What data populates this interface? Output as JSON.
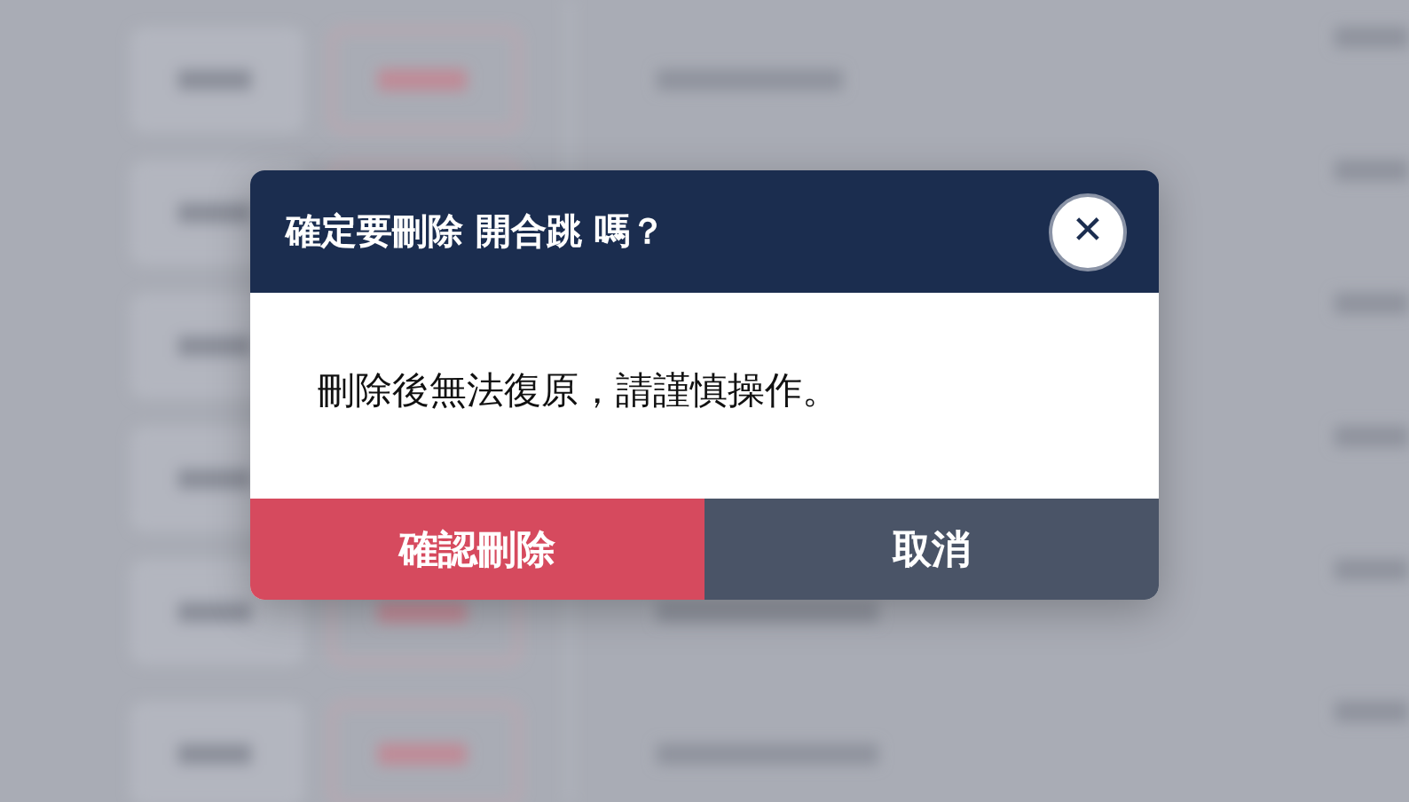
{
  "dialog": {
    "title": "確定要刪除 開合跳 嗎？",
    "close_icon": "✕",
    "message": "刪除後無法復原，請謹慎操作。",
    "buttons": [
      {
        "label": "確認刪除",
        "kind": "danger"
      },
      {
        "label": "取消",
        "kind": "cancel"
      }
    ]
  }
}
